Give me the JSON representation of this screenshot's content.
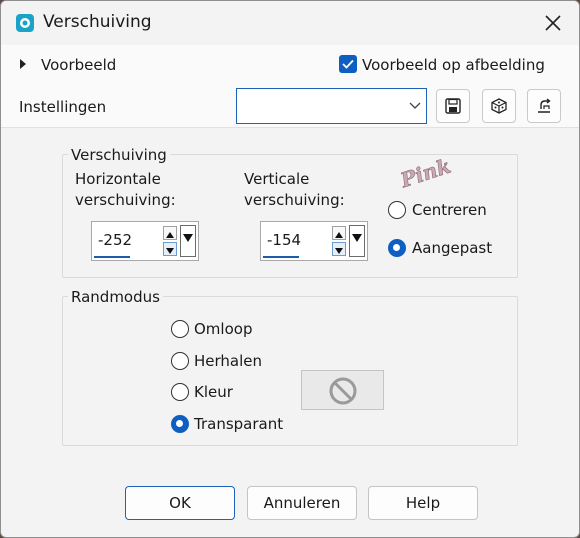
{
  "window": {
    "title": "Verschuiving"
  },
  "preview": {
    "toggle_label": "Voorbeeld",
    "checkbox_label": "Voorbeeld op afbeelding",
    "checked": true
  },
  "settings": {
    "label": "Instellingen",
    "dropdown_value": ""
  },
  "offset": {
    "group_label": "Verschuiving",
    "horizontal_label_1": "Horizontale",
    "horizontal_label_2": "verschuiving:",
    "horizontal_value": "-252",
    "vertical_label_1": "Verticale",
    "vertical_label_2": "verschuiving:",
    "vertical_value": "-154",
    "center_label": "Centreren",
    "custom_label": "Aangepast",
    "selected": "custom"
  },
  "edge": {
    "group_label": "Randmodus",
    "options": [
      "Omloop",
      "Herhalen",
      "Kleur",
      "Transparant"
    ],
    "selected": "Transparant"
  },
  "watermark": "Pink",
  "buttons": {
    "ok": "OK",
    "cancel": "Annuleren",
    "help": "Help"
  },
  "colors": {
    "accent": "#0f5fc2"
  }
}
